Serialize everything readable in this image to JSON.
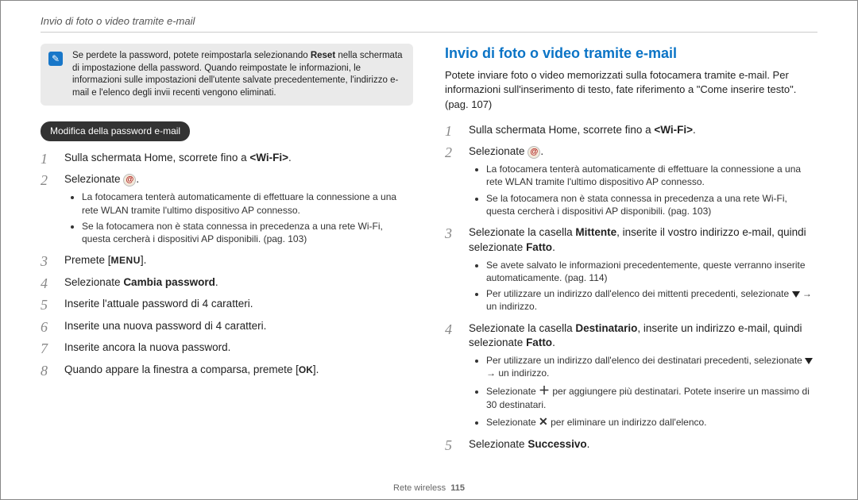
{
  "header": "Invio di foto o video tramite e-mail",
  "note": {
    "pre": "Se perdete la password, potete reimpostarla selezionando ",
    "bold": "Reset",
    "post": " nella schermata di impostazione della password. Quando reimpostate le informazioni, le informazioni sulle impostazioni dell'utente salvate precedentemente, l'indirizzo e-mail e l'elenco degli invii recenti vengono eliminati."
  },
  "left": {
    "subheading": "Modifica della password e-mail",
    "steps": {
      "s1": {
        "pre": "Sulla schermata Home, scorrete fino a ",
        "bold": "<Wi-Fi>",
        "post": "."
      },
      "s2": {
        "text": "Selezionate",
        "post": "."
      },
      "s2b": [
        "La fotocamera tenterà automaticamente di effettuare la connessione a una rete WLAN tramite l'ultimo dispositivo AP connesso.",
        "Se la fotocamera non è stata connessa in precedenza a una rete Wi-Fi, questa cercherà i dispositivi AP disponibili. (pag. 103)"
      ],
      "s3": {
        "pre": "Premete [",
        "menu": "MENU",
        "post": "]."
      },
      "s4": {
        "pre": "Selezionate ",
        "bold": "Cambia password",
        "post": "."
      },
      "s5": "Inserite l'attuale password di 4 caratteri.",
      "s6": "Inserite una nuova password di 4 caratteri.",
      "s7": "Inserite ancora la nuova password.",
      "s8": {
        "pre": "Quando appare la finestra a comparsa, premete [",
        "ok": "OK",
        "post": "]."
      }
    }
  },
  "right": {
    "title": "Invio di foto o video tramite e-mail",
    "intro": "Potete inviare foto o video memorizzati sulla fotocamera tramite e-mail. Per informazioni sull'inserimento di testo, fate riferimento a \"Come inserire testo\". (pag. 107)",
    "steps": {
      "s1": {
        "pre": "Sulla schermata Home, scorrete fino a ",
        "bold": "<Wi-Fi>",
        "post": "."
      },
      "s2": {
        "text": "Selezionate",
        "post": "."
      },
      "s2b": [
        "La fotocamera tenterà automaticamente di effettuare la connessione a una rete WLAN tramite l'ultimo dispositivo AP connesso.",
        "Se la fotocamera non è stata connessa in precedenza a una rete Wi-Fi, questa cercherà i dispositivi AP disponibili. (pag. 103)"
      ],
      "s3": {
        "pre1": "Selezionate la casella ",
        "b1": "Mittente",
        "mid": ", inserite il vostro indirizzo e-mail, quindi selezionate ",
        "b2": "Fatto",
        "post": "."
      },
      "s3b": {
        "a": "Se avete salvato le informazioni precedentemente, queste verranno inserite automaticamente. (pag. 114)",
        "b_pre": "Per utilizzare un indirizzo dall'elenco dei mittenti precedenti, selezionate ",
        "b_post": " → un indirizzo."
      },
      "s4": {
        "pre1": "Selezionate la casella ",
        "b1": "Destinatario",
        "mid": ", inserite un indirizzo e-mail, quindi selezionate ",
        "b2": "Fatto",
        "post": "."
      },
      "s4b": {
        "a_pre": "Per utilizzare un indirizzo dall'elenco dei destinatari precedenti, selezionate ",
        "a_post": " → un indirizzo.",
        "b_pre": "Selezionate ",
        "b_post": " per aggiungere più destinatari. Potete inserire un massimo di 30 destinatari.",
        "c_pre": "Selezionate ",
        "c_post": " per eliminare un indirizzo dall'elenco."
      },
      "s5": {
        "pre": "Selezionate ",
        "bold": "Successivo",
        "post": "."
      }
    }
  },
  "footer": {
    "label": "Rete wireless",
    "page": "115"
  }
}
